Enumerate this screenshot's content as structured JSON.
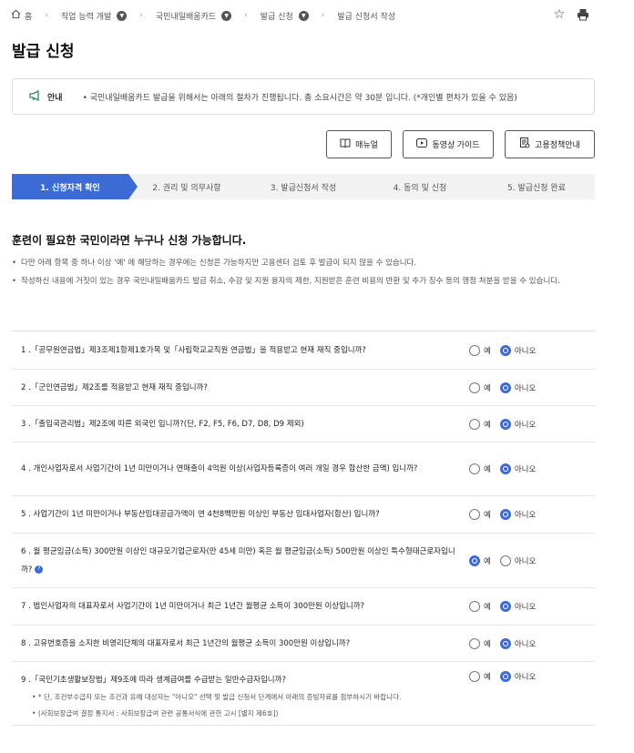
{
  "breadcrumb": {
    "home": "홈",
    "items": [
      "직업 능력 개발",
      "국민내일배움카드",
      "발급 신청",
      "발급 신청서 작성"
    ]
  },
  "page_title": "발급 신청",
  "notice": {
    "label": "안내",
    "text": "• 국민내일배움카드 발급을 위해서는 아래의 절차가 진행됩니다. 총 소요시간은 약 30분 입니다. (*개인별 편차가 있을 수 있음)"
  },
  "guide_buttons": [
    {
      "label": "매뉴얼",
      "icon": "book-icon"
    },
    {
      "label": "동영상 가이드",
      "icon": "play-icon"
    },
    {
      "label": "고용정책안내",
      "icon": "document-icon"
    }
  ],
  "steps": [
    "1. 신청자격 확인",
    "2. 권리 및 의무사항",
    "3. 발급신청서 작성",
    "4. 동의 및 신청",
    "5. 발급신청 완료"
  ],
  "section_heading": "훈련이 필요한 국민이라면 누구나 신청 가능합니다.",
  "guides": [
    "다만 아래 항목 중 하나 이상 '예' 에 해당하는 경우에는 신청은 가능하지만 고용센터 검토 후 발급이 되지 않을 수 있습니다.",
    "작성하신 내용에 거짓이 있는 경우 국민내일배움카드 발급 취소, 수강 및 지원 융자의 제한, 지원받은 훈련 비용의 반환 및 추가 징수 등의 행정 처분을 받을 수 있습니다."
  ],
  "options": {
    "yes": "예",
    "no": "아니오"
  },
  "questions": [
    {
      "text": "1 .「공무원연금법」제3조제1항제1호가목 및「사립학교교직원 연금법」을 적용받고 현재 재직 중입니까?",
      "answer": "no"
    },
    {
      "text": "2 .「군인연금법」제2조를 적용받고 현재 재직 중입니까?",
      "answer": "no"
    },
    {
      "text": "3 .「출입국관리법」제2조에 따른 외국인 입니까?(단, F2, F5, F6, D7, D8, D9 제외)",
      "answer": "no"
    },
    {
      "text": "4 . 개인사업자로서 사업기간이 1년 미만이거나 연매출이 4억원 이상(사업자등록증이 여러 개일 경우 합산한 금액) 입니까?",
      "answer": "no"
    },
    {
      "text": "5 . 사업기간이 1년 미만이거나 부동산임대공급가액이 연 4천8백만원 이상인 부동산 임대사업자(합산) 입니까?",
      "answer": "no"
    },
    {
      "text": "6 . 월 평균임금(소득) 300만원 이상인 대규모기업근로자(만 45세 미만) 혹은 월 평균임금(소득) 500만원 이상인 특수형태근로자입니까?",
      "answer": "yes",
      "help": "?"
    },
    {
      "text": "7 . 법인사업자의 대표자로서 사업기간이 1년 미만이거나 최근 1년간 월평균 소득이 300만원 이상입니까?",
      "answer": "no"
    },
    {
      "text": "8 . 고유번호증을 소지한 비영리단체의 대표자로서 최근 1년간의 월평균 소득이 300만원 이상입니까?",
      "answer": "no"
    },
    {
      "text": "9 .「국민기초생활보장법」제9조에 따라 생계급여를 수급받는 일반수급자입니까?",
      "answer": "no"
    }
  ],
  "q9_notes": [
    "* 단, 조건부수급자 또는 조건과 유예 대상자는 \"아니오\" 선택 및 발급 신청서 단계에서 아래의 증빙자료를 첨부하시기 바랍니다.",
    "(사회보장급여 결정 통지서 : 사회보장급여 관련 공통서식에 관한 고시 [별지 제6호])"
  ],
  "colors": {
    "accent": "#3d6bd6",
    "step_inactive": "#f2f2f2",
    "notice_icon": "#2e8b57"
  }
}
